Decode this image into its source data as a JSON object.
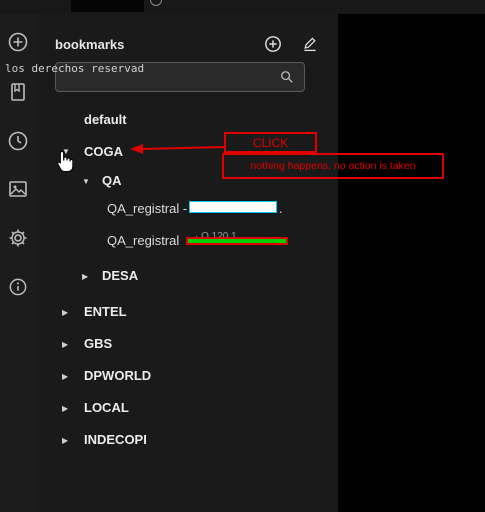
{
  "sidebar": {
    "title": "bookmarks",
    "search": {
      "value": "",
      "placeholder": ""
    },
    "tree": {
      "default": "default",
      "coga": "COGA",
      "qa": "QA",
      "qa_item_1_visible": "QA_registral -",
      "qa_item_1_suffix": ".",
      "qa_item_2_visible": "QA_registral",
      "qa_item_2_fragment": "· O 120.1",
      "desa": "DESA",
      "entel": "ENTEL",
      "gbs": "GBS",
      "dpworld": "DPWORLD",
      "local": "LOCAL",
      "indecopi": "INDECOPI"
    }
  },
  "terminal": {
    "text": "los derechos reservad"
  },
  "annotation": {
    "click_label": "CLICK",
    "message": "nothing happens, no action is taken",
    "color": "#e00000"
  },
  "redaction_colors": {
    "white": "#ffffff",
    "cyan_outline": "#00c8ff",
    "green": "#00d200",
    "red_outline": "#e00000"
  },
  "icons": [
    "plus-circle-icon",
    "bookmark-icon",
    "clock-icon",
    "image-icon",
    "gear-icon",
    "info-icon",
    "edit-icon",
    "search-icon",
    "hand-pointer-icon"
  ]
}
